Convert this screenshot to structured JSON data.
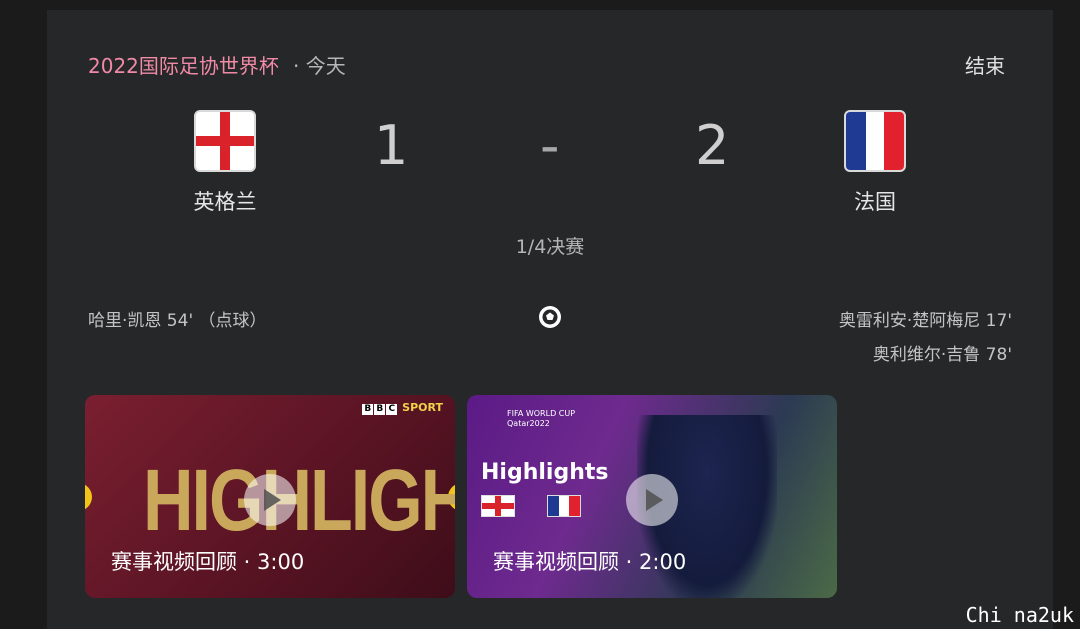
{
  "header": {
    "competition": "2022国际足协世界杯",
    "date_sep": "· 今天",
    "status": "结束"
  },
  "home": {
    "name": "英格兰",
    "score": "1",
    "flag_icon": "england-flag-icon"
  },
  "away": {
    "name": "法国",
    "score": "2",
    "flag_icon": "france-flag-icon"
  },
  "score_sep": "-",
  "stage": "1/4决赛",
  "scorers": {
    "home": [
      "哈里·凯恩 54' （点球）"
    ],
    "away": [
      "奥雷利安·楚阿梅尼 17'",
      "奥利维尔·吉鲁 78'"
    ]
  },
  "videos": [
    {
      "caption": "赛事视频回顾 · 3:00",
      "overlay_title": "HIGHLIGHTS",
      "brand": "SPORT",
      "brand_boxes": [
        "B",
        "B",
        "C"
      ]
    },
    {
      "caption": "赛事视频回顾 · 2:00",
      "overlay_title": "Highlights",
      "brand_line1": "FIFA WORLD CUP",
      "brand_line2": "Qatar2022"
    }
  ],
  "watermark": "Chi na2uk",
  "colors": {
    "accent_pink": "#f08aa6",
    "card_bg": "#262729",
    "page_bg": "#1b1b1c"
  }
}
